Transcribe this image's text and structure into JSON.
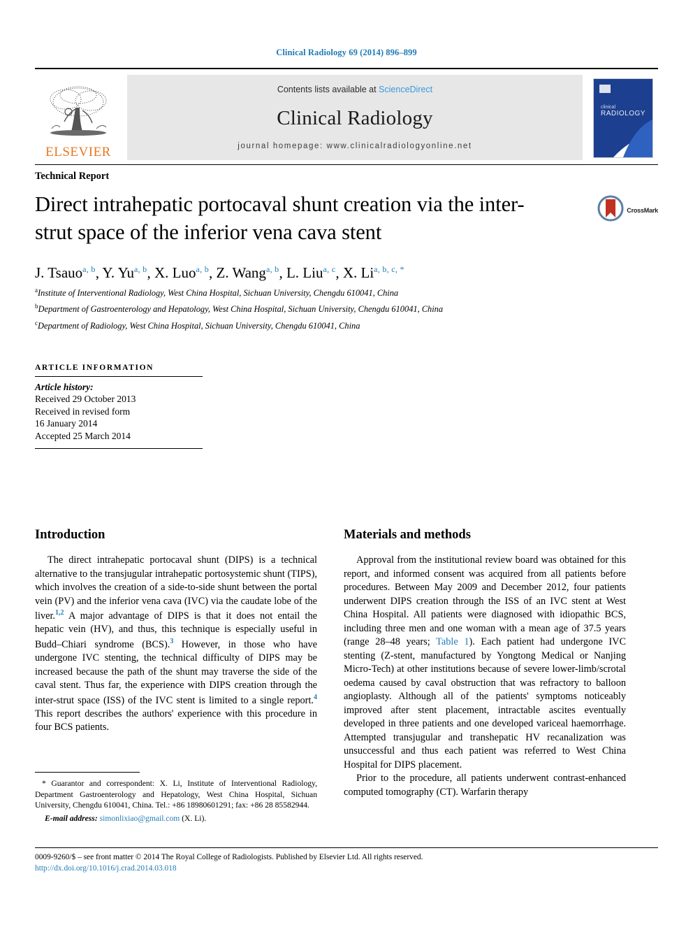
{
  "running_head": "Clinical Radiology 69 (2014) 896–899",
  "masthead": {
    "publisher_logo_label": "ELSEVIER",
    "contents_prefix": "Contents lists available at ",
    "contents_link": "ScienceDirect",
    "journal_title": "Clinical Radiology",
    "homepage_line": "journal homepage: www.clinicalradiologyonline.net",
    "cover_line1": "clinical",
    "cover_line2": "RADIOLOGY"
  },
  "article": {
    "doctype": "Technical Report",
    "title": "Direct intrahepatic portocaval shunt creation via the inter-strut space of the inferior vena cava stent",
    "crossmark_label": "CrossMark",
    "authors": [
      {
        "name": "J. Tsauo",
        "marks": "a, b",
        "sep": ", "
      },
      {
        "name": "Y. Yu",
        "marks": "a, b",
        "sep": ", "
      },
      {
        "name": "X. Luo",
        "marks": "a, b",
        "sep": ", "
      },
      {
        "name": "Z. Wang",
        "marks": "a, b",
        "sep": ", "
      },
      {
        "name": "L. Liu",
        "marks": "a, c",
        "sep": ", "
      },
      {
        "name": "X. Li",
        "marks": "a, b, c, *",
        "sep": ""
      }
    ],
    "affiliations": [
      {
        "mark": "a",
        "text": "Institute of Interventional Radiology, West China Hospital, Sichuan University, Chengdu 610041, China"
      },
      {
        "mark": "b",
        "text": "Department of Gastroenterology and Hepatology, West China Hospital, Sichuan University, Chengdu 610041, China"
      },
      {
        "mark": "c",
        "text": "Department of Radiology, West China Hospital, Sichuan University, Chengdu 610041, China"
      }
    ]
  },
  "article_info": {
    "heading": "ARTICLE INFORMATION",
    "history_label": "Article history:",
    "received": "Received 29 October 2013",
    "revised_label": "Received in revised form",
    "revised_date": "16 January 2014",
    "accepted": "Accepted 25 March 2014"
  },
  "sections": {
    "introduction": {
      "heading": "Introduction",
      "paragraph_1a": "The direct intrahepatic portocaval shunt (DIPS) is a technical alternative to the transjugular intrahepatic portosystemic shunt (TIPS), which involves the creation of a side-to-side shunt between the portal vein (PV) and the inferior vena cava (IVC) via the caudate lobe of the liver.",
      "ref_1": "1,2",
      "paragraph_1b": " A major advantage of DIPS is that it does not entail the hepatic vein (HV), and thus, this technique is especially useful in Budd–Chiari syndrome (BCS).",
      "ref_2": "3",
      "paragraph_1c": " However, in those who have undergone IVC stenting, the technical difficulty of DIPS may be increased because the path of the shunt may traverse the side of the caval stent. Thus far, the experience with DIPS creation through the inter-strut space (ISS) of the IVC stent is limited to a single report.",
      "ref_3": "4",
      "paragraph_1d": " This report describes the authors' experience with this procedure in four BCS patients."
    },
    "materials": {
      "heading": "Materials and methods",
      "paragraph_1a": "Approval from the institutional review board was obtained for this report, and informed consent was acquired from all patients before procedures. Between May 2009 and December 2012, four patients underwent DIPS creation through the ISS of an IVC stent at West China Hospital. All patients were diagnosed with idiopathic BCS, including three men and one woman with a mean age of 37.5 years (range 28–48 years; ",
      "table_link": "Table 1",
      "paragraph_1b": "). Each patient had undergone IVC stenting (Z-stent, manufactured by Yongtong Medical or Nanjing Micro-Tech) at other institutions because of severe lower-limb/scrotal oedema caused by caval obstruction that was refractory to balloon angioplasty. Although all of the patients' symptoms noticeably improved after stent placement, intractable ascites eventually developed in three patients and one developed variceal haemorrhage. Attempted transjugular and transhepatic HV recanalization was unsuccessful and thus each patient was referred to West China Hospital for DIPS placement.",
      "paragraph_2": "Prior to the procedure, all patients underwent contrast-enhanced computed tomography (CT). Warfarin therapy"
    }
  },
  "footnote": {
    "correspondence": "* Guarantor and correspondent: X. Li, Institute of Interventional Radiology, Department Gastroenterology and Hepatology, West China Hospital, Sichuan University, Chengdu 610041, China. Tel.: +86 18980601291; fax: +86 28 85582944.",
    "email_label": "E-mail address:",
    "email": "simonlixiao@gmail.com",
    "email_owner": "(X. Li)."
  },
  "page_footer": {
    "copyright": "0009-9260/$ – see front matter © 2014 The Royal College of Radiologists. Published by Elsevier Ltd. All rights reserved.",
    "doi": "http://dx.doi.org/10.1016/j.crad.2014.03.018"
  },
  "colors": {
    "link_blue": "#1f7bb6",
    "sciencedirect_blue": "#3a9ad9",
    "elsevier_orange": "#e87722",
    "band_grey": "#e7e7e7",
    "crossmark_red": "#c0311f"
  }
}
